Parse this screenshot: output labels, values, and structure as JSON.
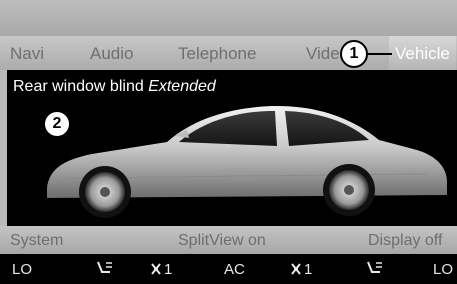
{
  "nav": {
    "items": [
      {
        "label": "Navi"
      },
      {
        "label": "Audio"
      },
      {
        "label": "Telephone"
      },
      {
        "label": "Vide"
      },
      {
        "label": "Vehicle"
      }
    ]
  },
  "main": {
    "label": "Rear window blind",
    "status": "Extended"
  },
  "callouts": {
    "one": "1",
    "two": "2"
  },
  "function_bar": {
    "left": "System",
    "center": "SplitView on",
    "right": "Display off"
  },
  "climate": {
    "left_temp": "LO",
    "left_fan": "1",
    "ac": "AC",
    "right_fan": "1",
    "right_temp": "LO",
    "icons": [
      "seat-airflow-icon",
      "fan-icon",
      "fan-icon",
      "seat-airflow-icon"
    ]
  }
}
